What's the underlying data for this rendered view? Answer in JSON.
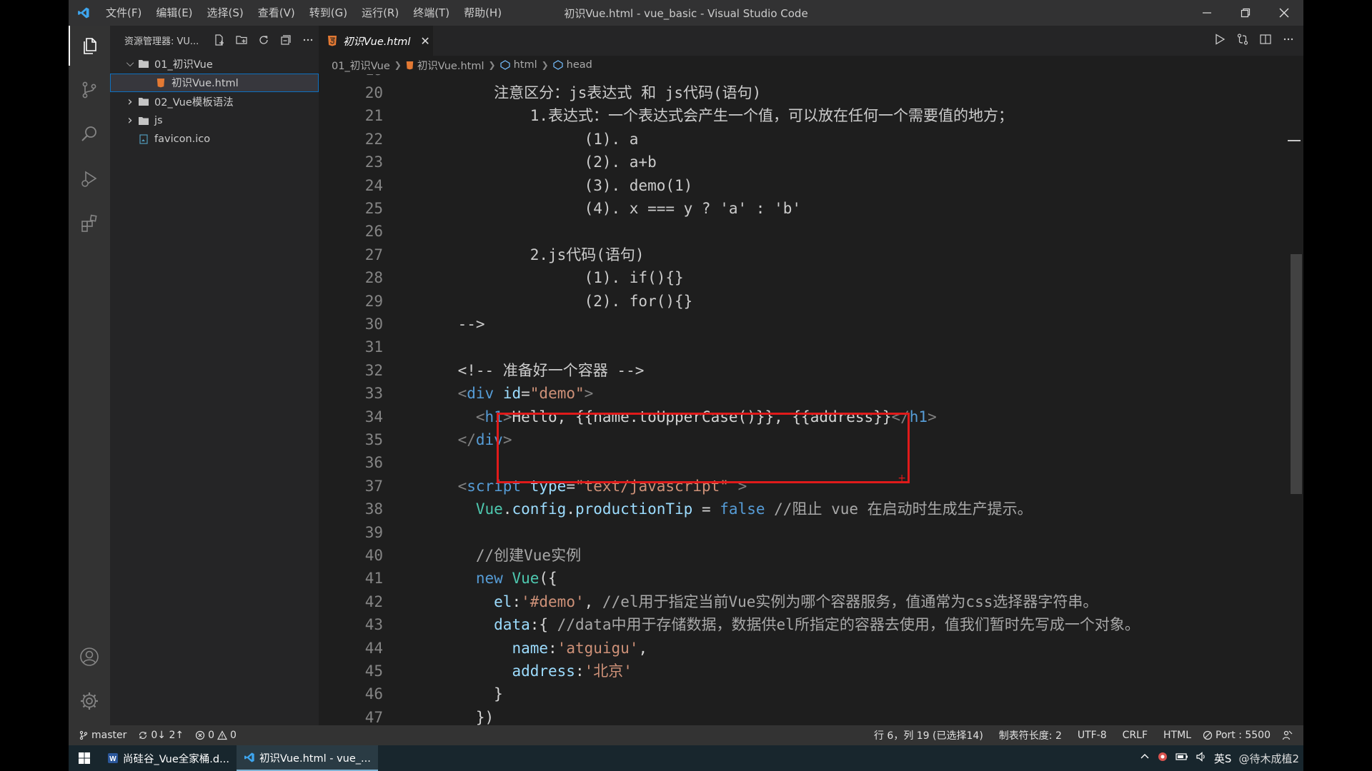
{
  "titlebar": {
    "menus": [
      "文件(F)",
      "编辑(E)",
      "选择(S)",
      "查看(V)",
      "转到(G)",
      "运行(R)",
      "终端(T)",
      "帮助(H)"
    ],
    "window_title": "初识Vue.html - vue_basic - Visual Studio Code"
  },
  "sidebar": {
    "title": "资源管理器: VU...",
    "tree": [
      {
        "label": "01_初识Vue",
        "type": "folder",
        "expanded": true,
        "depth": 0
      },
      {
        "label": "初识Vue.html",
        "type": "html-file",
        "depth": 1,
        "selected": true
      },
      {
        "label": "02_Vue模板语法",
        "type": "folder",
        "expanded": false,
        "depth": 0
      },
      {
        "label": "js",
        "type": "folder",
        "expanded": false,
        "depth": 0
      },
      {
        "label": "favicon.ico",
        "type": "image-file",
        "depth": 0
      }
    ]
  },
  "editor": {
    "active_tab": "初识Vue.html",
    "breadcrumb": [
      "01_初识Vue",
      "初识Vue.html",
      "html",
      "head"
    ]
  },
  "code_lines": [
    {
      "n": "20",
      "parts": [
        [
          "c-comment",
          "        注意区分：js表达式 和 js代码(语句)"
        ]
      ]
    },
    {
      "n": "21",
      "parts": [
        [
          "c-comment",
          "            1.表达式：一个表达式会产生一个值，可以放在任何一个需要值的地方；"
        ]
      ]
    },
    {
      "n": "22",
      "parts": [
        [
          "c-comment",
          "                  (1). a"
        ]
      ]
    },
    {
      "n": "23",
      "parts": [
        [
          "c-comment",
          "                  (2). a+b"
        ]
      ]
    },
    {
      "n": "24",
      "parts": [
        [
          "c-comment",
          "                  (3). demo(1)"
        ]
      ]
    },
    {
      "n": "25",
      "parts": [
        [
          "c-comment",
          "                  (4). x === y ? 'a' : 'b'"
        ]
      ]
    },
    {
      "n": "26",
      "parts": []
    },
    {
      "n": "27",
      "parts": [
        [
          "c-comment",
          "            2.js代码(语句)"
        ]
      ]
    },
    {
      "n": "28",
      "parts": [
        [
          "c-comment",
          "                  (1). if(){}"
        ]
      ]
    },
    {
      "n": "29",
      "parts": [
        [
          "c-comment",
          "                  (2). for(){}"
        ]
      ]
    },
    {
      "n": "30",
      "parts": [
        [
          "c-comment",
          "    -->"
        ]
      ]
    },
    {
      "n": "31",
      "parts": []
    },
    {
      "n": "32",
      "parts": [
        [
          "c-comment",
          "    <!-- 准备好一个容器 -->"
        ]
      ]
    },
    {
      "n": "33",
      "parts": [
        [
          "c-text",
          "    "
        ],
        [
          "c-punct",
          "<"
        ],
        [
          "c-tag",
          "div"
        ],
        [
          "c-text",
          " "
        ],
        [
          "c-attr",
          "id"
        ],
        [
          "c-text",
          "="
        ],
        [
          "c-str",
          "\"demo\""
        ],
        [
          "c-punct",
          ">"
        ]
      ]
    },
    {
      "n": "34",
      "parts": [
        [
          "c-text",
          "      "
        ],
        [
          "c-punct",
          "<"
        ],
        [
          "c-tag",
          "h1"
        ],
        [
          "c-punct",
          ">"
        ],
        [
          "c-text",
          "Hello, {{name.toUpperCase()}}, {{address}}"
        ],
        [
          "c-punct",
          "</"
        ],
        [
          "c-tag",
          "h1"
        ],
        [
          "c-punct",
          ">"
        ]
      ]
    },
    {
      "n": "35",
      "parts": [
        [
          "c-text",
          "    "
        ],
        [
          "c-punct",
          "</"
        ],
        [
          "c-tag",
          "div"
        ],
        [
          "c-punct",
          ">"
        ]
      ]
    },
    {
      "n": "36",
      "parts": []
    },
    {
      "n": "37",
      "parts": [
        [
          "c-text",
          "    "
        ],
        [
          "c-punct",
          "<"
        ],
        [
          "c-tag",
          "script"
        ],
        [
          "c-text",
          " "
        ],
        [
          "c-attr",
          "type"
        ],
        [
          "c-text",
          "="
        ],
        [
          "c-str",
          "\"text/javascript\""
        ],
        [
          "c-text",
          " "
        ],
        [
          "c-punct",
          ">"
        ]
      ]
    },
    {
      "n": "38",
      "parts": [
        [
          "c-text",
          "      "
        ],
        [
          "c-cls",
          "Vue"
        ],
        [
          "c-text",
          "."
        ],
        [
          "c-prop",
          "config"
        ],
        [
          "c-text",
          "."
        ],
        [
          "c-prop",
          "productionTip"
        ],
        [
          "c-text",
          " = "
        ],
        [
          "c-kw",
          "false"
        ],
        [
          "c-text",
          " "
        ],
        [
          "c-gray",
          "//阻止 vue 在启动时生成生产提示。"
        ]
      ]
    },
    {
      "n": "39",
      "parts": []
    },
    {
      "n": "40",
      "parts": [
        [
          "c-text",
          "      "
        ],
        [
          "c-gray",
          "//创建Vue实例"
        ]
      ]
    },
    {
      "n": "41",
      "parts": [
        [
          "c-text",
          "      "
        ],
        [
          "c-kw",
          "new"
        ],
        [
          "c-text",
          " "
        ],
        [
          "c-cls",
          "Vue"
        ],
        [
          "c-text",
          "({"
        ]
      ]
    },
    {
      "n": "42",
      "parts": [
        [
          "c-text",
          "        "
        ],
        [
          "c-prop",
          "el"
        ],
        [
          "c-text",
          ":"
        ],
        [
          "c-str",
          "'#demo'"
        ],
        [
          "c-text",
          ", "
        ],
        [
          "c-gray",
          "//el用于指定当前Vue实例为哪个容器服务，值通常为css选择器字符串。"
        ]
      ]
    },
    {
      "n": "43",
      "parts": [
        [
          "c-text",
          "        "
        ],
        [
          "c-prop",
          "data"
        ],
        [
          "c-text",
          ":{ "
        ],
        [
          "c-gray",
          "//data中用于存储数据，数据供el所指定的容器去使用，值我们暂时先写成一个对象。"
        ]
      ]
    },
    {
      "n": "44",
      "parts": [
        [
          "c-text",
          "          "
        ],
        [
          "c-prop",
          "name"
        ],
        [
          "c-text",
          ":"
        ],
        [
          "c-str",
          "'atguigu'"
        ],
        [
          "c-text",
          ","
        ]
      ]
    },
    {
      "n": "45",
      "parts": [
        [
          "c-text",
          "          "
        ],
        [
          "c-prop",
          "address"
        ],
        [
          "c-text",
          ":"
        ],
        [
          "c-str",
          "'北京'"
        ]
      ]
    },
    {
      "n": "46",
      "parts": [
        [
          "c-text",
          "        }"
        ]
      ]
    },
    {
      "n": "47",
      "parts": [
        [
          "c-text",
          "      })"
        ]
      ]
    }
  ],
  "statusbar": {
    "branch": "master",
    "sync": "0↓ 2↑",
    "errors": "0",
    "warnings": "0",
    "cursor": "行 6，列 19 (已选择14)",
    "tab_size": "制表符长度: 2",
    "encoding": "UTF-8",
    "eol": "CRLF",
    "language": "HTML",
    "port": "Port : 5500"
  },
  "taskbar": {
    "items": [
      {
        "label": "尚硅谷_Vue全家桶.d...",
        "icon": "word-icon"
      },
      {
        "label": "初识Vue.html - vue_...",
        "icon": "vscode-icon",
        "active": true
      }
    ],
    "tray_text": "英S",
    "watermark": "@待木成植2"
  },
  "colors": {
    "accent": "#0e70c0",
    "highlight_box": "#e01a1a"
  }
}
